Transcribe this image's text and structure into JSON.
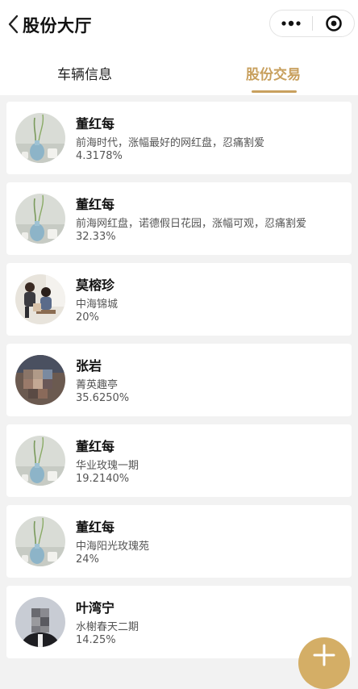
{
  "header": {
    "title": "股份大厅"
  },
  "tabs": [
    {
      "label": "车辆信息",
      "active": false
    },
    {
      "label": "股份交易",
      "active": true
    }
  ],
  "accent_color": "#c8a05e",
  "items": [
    {
      "name": "董红每",
      "desc": "前海时代，涨幅最好的网红盘，忍痛割爱",
      "pct": "4.3178%",
      "avatar": "vase-photo"
    },
    {
      "name": "董红每",
      "desc": "前海网红盘，诺德假日花园，涨幅可观，忍痛割爱",
      "pct": "32.33%",
      "avatar": "vase-photo"
    },
    {
      "name": "莫榕珍",
      "desc": "中海锦城",
      "pct": "20%",
      "avatar": "family-photo"
    },
    {
      "name": "张岩",
      "desc": "菁英趣亭",
      "pct": "35.6250%",
      "avatar": "blurred-photo"
    },
    {
      "name": "董红每",
      "desc": "华业玫瑰一期",
      "pct": "19.2140%",
      "avatar": "vase-photo"
    },
    {
      "name": "董红每",
      "desc": "中海阳光玫瑰苑",
      "pct": "24%",
      "avatar": "vase-photo"
    },
    {
      "name": "叶湾宁",
      "desc": "水榭春天二期",
      "pct": "14.25%",
      "avatar": "blurred-portrait"
    }
  ]
}
